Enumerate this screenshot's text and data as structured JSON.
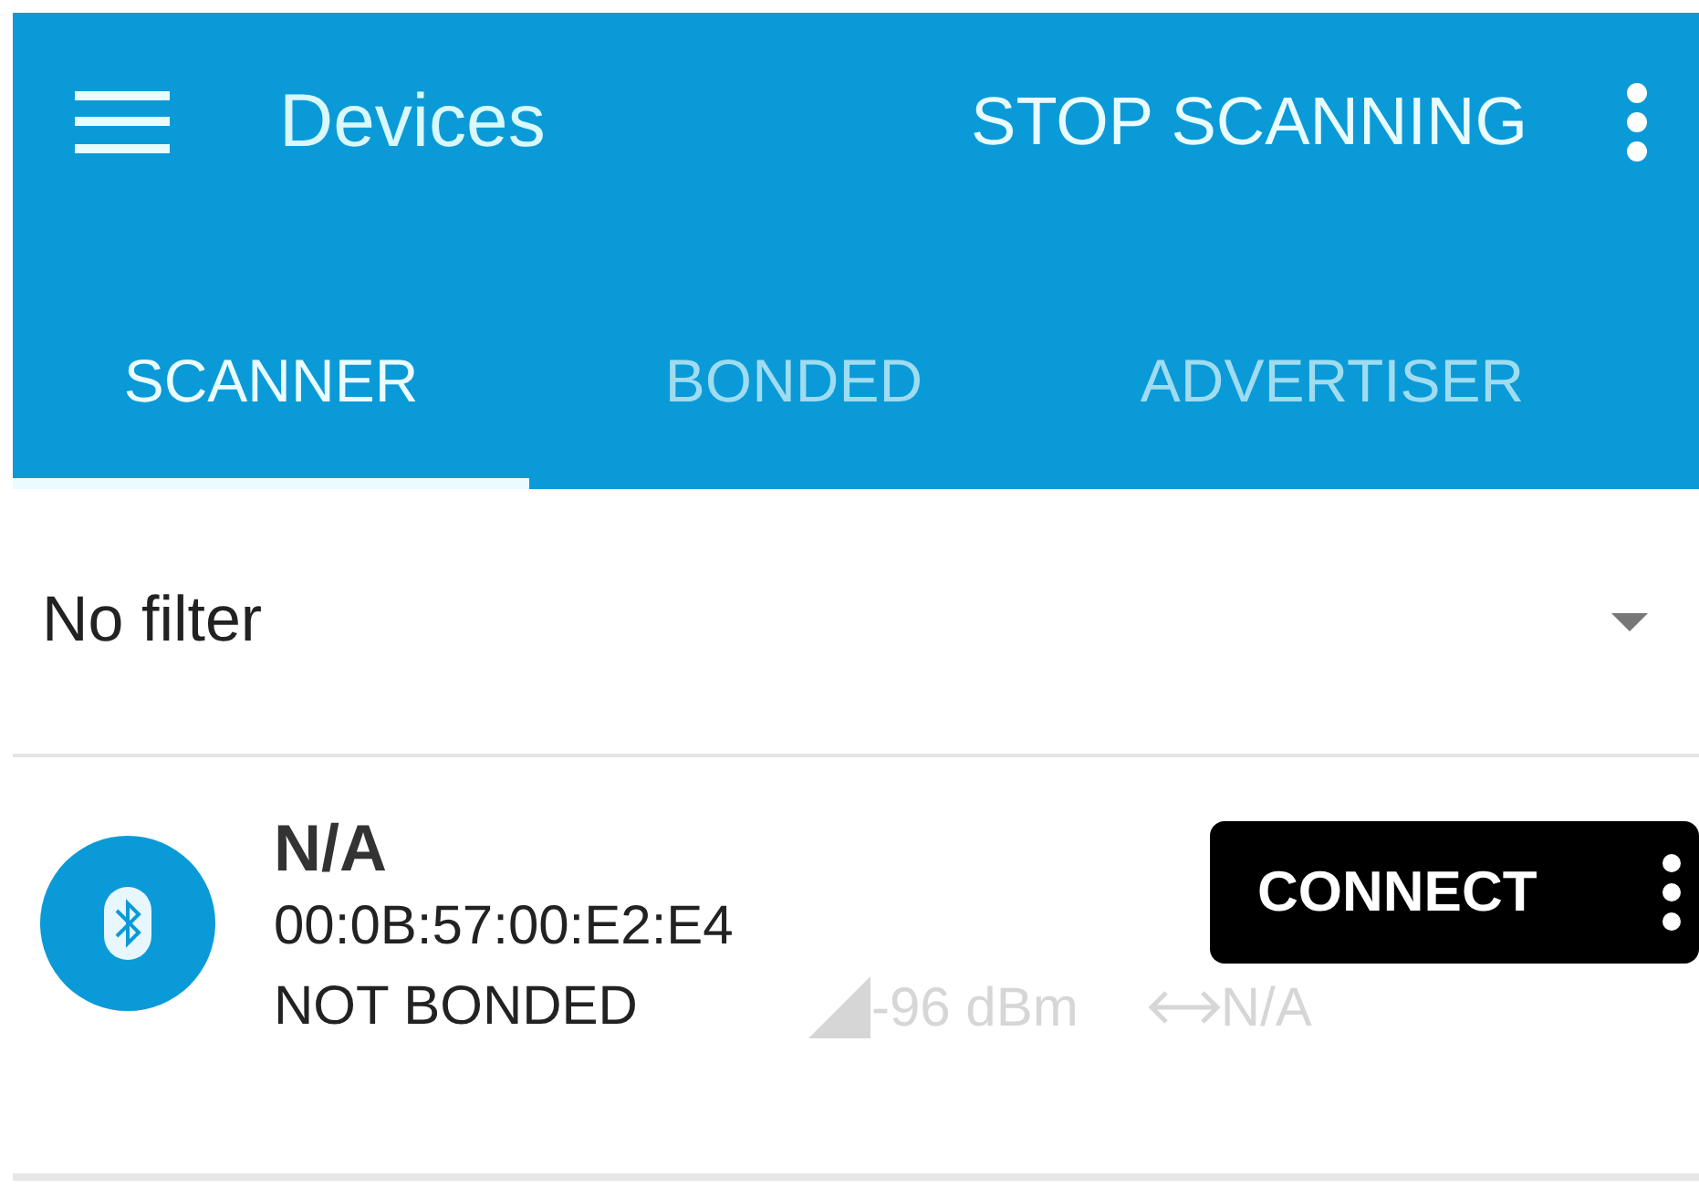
{
  "toolbar": {
    "title": "Devices",
    "action": "STOP SCANNING"
  },
  "tabs": [
    {
      "label": "SCANNER",
      "selected": true
    },
    {
      "label": "BONDED",
      "selected": false
    },
    {
      "label": "ADVERTISER",
      "selected": false
    }
  ],
  "filter": {
    "value": "No filter"
  },
  "devices": [
    {
      "name": "N/A",
      "address": "00:0B:57:00:E2:E4",
      "bond_state": "NOT BONDED",
      "rssi": "-96 dBm",
      "interval": "N/A",
      "button": "CONNECT"
    }
  ]
}
